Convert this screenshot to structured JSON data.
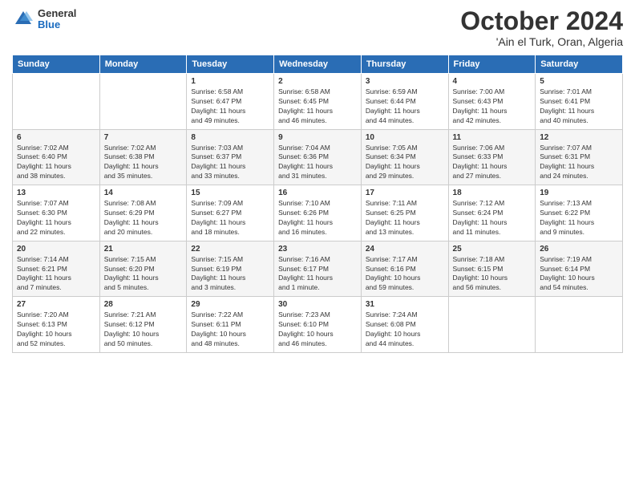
{
  "logo": {
    "general": "General",
    "blue": "Blue"
  },
  "title": "October 2024",
  "location": "'Ain el Turk, Oran, Algeria",
  "days_header": [
    "Sunday",
    "Monday",
    "Tuesday",
    "Wednesday",
    "Thursday",
    "Friday",
    "Saturday"
  ],
  "weeks": [
    [
      {
        "day": "",
        "info": ""
      },
      {
        "day": "",
        "info": ""
      },
      {
        "day": "1",
        "info": "Sunrise: 6:58 AM\nSunset: 6:47 PM\nDaylight: 11 hours\nand 49 minutes."
      },
      {
        "day": "2",
        "info": "Sunrise: 6:58 AM\nSunset: 6:45 PM\nDaylight: 11 hours\nand 46 minutes."
      },
      {
        "day": "3",
        "info": "Sunrise: 6:59 AM\nSunset: 6:44 PM\nDaylight: 11 hours\nand 44 minutes."
      },
      {
        "day": "4",
        "info": "Sunrise: 7:00 AM\nSunset: 6:43 PM\nDaylight: 11 hours\nand 42 minutes."
      },
      {
        "day": "5",
        "info": "Sunrise: 7:01 AM\nSunset: 6:41 PM\nDaylight: 11 hours\nand 40 minutes."
      }
    ],
    [
      {
        "day": "6",
        "info": "Sunrise: 7:02 AM\nSunset: 6:40 PM\nDaylight: 11 hours\nand 38 minutes."
      },
      {
        "day": "7",
        "info": "Sunrise: 7:02 AM\nSunset: 6:38 PM\nDaylight: 11 hours\nand 35 minutes."
      },
      {
        "day": "8",
        "info": "Sunrise: 7:03 AM\nSunset: 6:37 PM\nDaylight: 11 hours\nand 33 minutes."
      },
      {
        "day": "9",
        "info": "Sunrise: 7:04 AM\nSunset: 6:36 PM\nDaylight: 11 hours\nand 31 minutes."
      },
      {
        "day": "10",
        "info": "Sunrise: 7:05 AM\nSunset: 6:34 PM\nDaylight: 11 hours\nand 29 minutes."
      },
      {
        "day": "11",
        "info": "Sunrise: 7:06 AM\nSunset: 6:33 PM\nDaylight: 11 hours\nand 27 minutes."
      },
      {
        "day": "12",
        "info": "Sunrise: 7:07 AM\nSunset: 6:31 PM\nDaylight: 11 hours\nand 24 minutes."
      }
    ],
    [
      {
        "day": "13",
        "info": "Sunrise: 7:07 AM\nSunset: 6:30 PM\nDaylight: 11 hours\nand 22 minutes."
      },
      {
        "day": "14",
        "info": "Sunrise: 7:08 AM\nSunset: 6:29 PM\nDaylight: 11 hours\nand 20 minutes."
      },
      {
        "day": "15",
        "info": "Sunrise: 7:09 AM\nSunset: 6:27 PM\nDaylight: 11 hours\nand 18 minutes."
      },
      {
        "day": "16",
        "info": "Sunrise: 7:10 AM\nSunset: 6:26 PM\nDaylight: 11 hours\nand 16 minutes."
      },
      {
        "day": "17",
        "info": "Sunrise: 7:11 AM\nSunset: 6:25 PM\nDaylight: 11 hours\nand 13 minutes."
      },
      {
        "day": "18",
        "info": "Sunrise: 7:12 AM\nSunset: 6:24 PM\nDaylight: 11 hours\nand 11 minutes."
      },
      {
        "day": "19",
        "info": "Sunrise: 7:13 AM\nSunset: 6:22 PM\nDaylight: 11 hours\nand 9 minutes."
      }
    ],
    [
      {
        "day": "20",
        "info": "Sunrise: 7:14 AM\nSunset: 6:21 PM\nDaylight: 11 hours\nand 7 minutes."
      },
      {
        "day": "21",
        "info": "Sunrise: 7:15 AM\nSunset: 6:20 PM\nDaylight: 11 hours\nand 5 minutes."
      },
      {
        "day": "22",
        "info": "Sunrise: 7:15 AM\nSunset: 6:19 PM\nDaylight: 11 hours\nand 3 minutes."
      },
      {
        "day": "23",
        "info": "Sunrise: 7:16 AM\nSunset: 6:17 PM\nDaylight: 11 hours\nand 1 minute."
      },
      {
        "day": "24",
        "info": "Sunrise: 7:17 AM\nSunset: 6:16 PM\nDaylight: 10 hours\nand 59 minutes."
      },
      {
        "day": "25",
        "info": "Sunrise: 7:18 AM\nSunset: 6:15 PM\nDaylight: 10 hours\nand 56 minutes."
      },
      {
        "day": "26",
        "info": "Sunrise: 7:19 AM\nSunset: 6:14 PM\nDaylight: 10 hours\nand 54 minutes."
      }
    ],
    [
      {
        "day": "27",
        "info": "Sunrise: 7:20 AM\nSunset: 6:13 PM\nDaylight: 10 hours\nand 52 minutes."
      },
      {
        "day": "28",
        "info": "Sunrise: 7:21 AM\nSunset: 6:12 PM\nDaylight: 10 hours\nand 50 minutes."
      },
      {
        "day": "29",
        "info": "Sunrise: 7:22 AM\nSunset: 6:11 PM\nDaylight: 10 hours\nand 48 minutes."
      },
      {
        "day": "30",
        "info": "Sunrise: 7:23 AM\nSunset: 6:10 PM\nDaylight: 10 hours\nand 46 minutes."
      },
      {
        "day": "31",
        "info": "Sunrise: 7:24 AM\nSunset: 6:08 PM\nDaylight: 10 hours\nand 44 minutes."
      },
      {
        "day": "",
        "info": ""
      },
      {
        "day": "",
        "info": ""
      }
    ]
  ]
}
